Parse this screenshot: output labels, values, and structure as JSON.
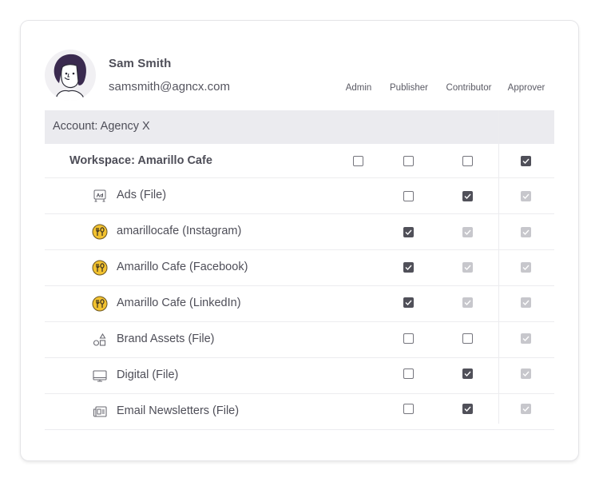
{
  "user": {
    "name": "Sam Smith",
    "email": "samsmith@agncx.com",
    "avatar_icon": "user-avatar-illustration"
  },
  "columns": [
    "Admin",
    "Publisher",
    "Contributor",
    "Approver"
  ],
  "account": {
    "label": "Account: Agency X"
  },
  "workspace": {
    "label": "Workspace: Amarillo Cafe",
    "permissions": {
      "admin": "unchecked",
      "publisher": "unchecked",
      "contributor": "unchecked",
      "approver": "checked"
    }
  },
  "items": [
    {
      "label": "Ads (File)",
      "icon": "ad-board-icon",
      "permissions": {
        "admin": null,
        "publisher": "unchecked",
        "contributor": "checked",
        "approver": "disabled"
      }
    },
    {
      "label": "amarillocafe (Instagram)",
      "icon": "restaurant-logo-icon",
      "permissions": {
        "admin": null,
        "publisher": "checked",
        "contributor": "disabled",
        "approver": "disabled"
      }
    },
    {
      "label": "Amarillo Cafe (Facebook)",
      "icon": "restaurant-logo-icon",
      "permissions": {
        "admin": null,
        "publisher": "checked",
        "contributor": "disabled",
        "approver": "disabled"
      }
    },
    {
      "label": "Amarillo Cafe (LinkedIn)",
      "icon": "restaurant-logo-icon",
      "permissions": {
        "admin": null,
        "publisher": "checked",
        "contributor": "disabled",
        "approver": "disabled"
      }
    },
    {
      "label": "Brand Assets (File)",
      "icon": "shapes-icon",
      "permissions": {
        "admin": null,
        "publisher": "unchecked",
        "contributor": "unchecked",
        "approver": "disabled"
      }
    },
    {
      "label": "Digital (File)",
      "icon": "monitor-icon",
      "permissions": {
        "admin": null,
        "publisher": "unchecked",
        "contributor": "checked",
        "approver": "disabled"
      }
    },
    {
      "label": "Email Newsletters (File)",
      "icon": "newsletter-icon",
      "permissions": {
        "admin": null,
        "publisher": "unchecked",
        "contributor": "checked",
        "approver": "disabled"
      }
    }
  ],
  "colors": {
    "checked": "#505059",
    "disabled": "#c7c7cc",
    "account_bg": "#ebebef",
    "logo_yellow": "#f2c230",
    "avatar_hair": "#3a2a4f"
  }
}
